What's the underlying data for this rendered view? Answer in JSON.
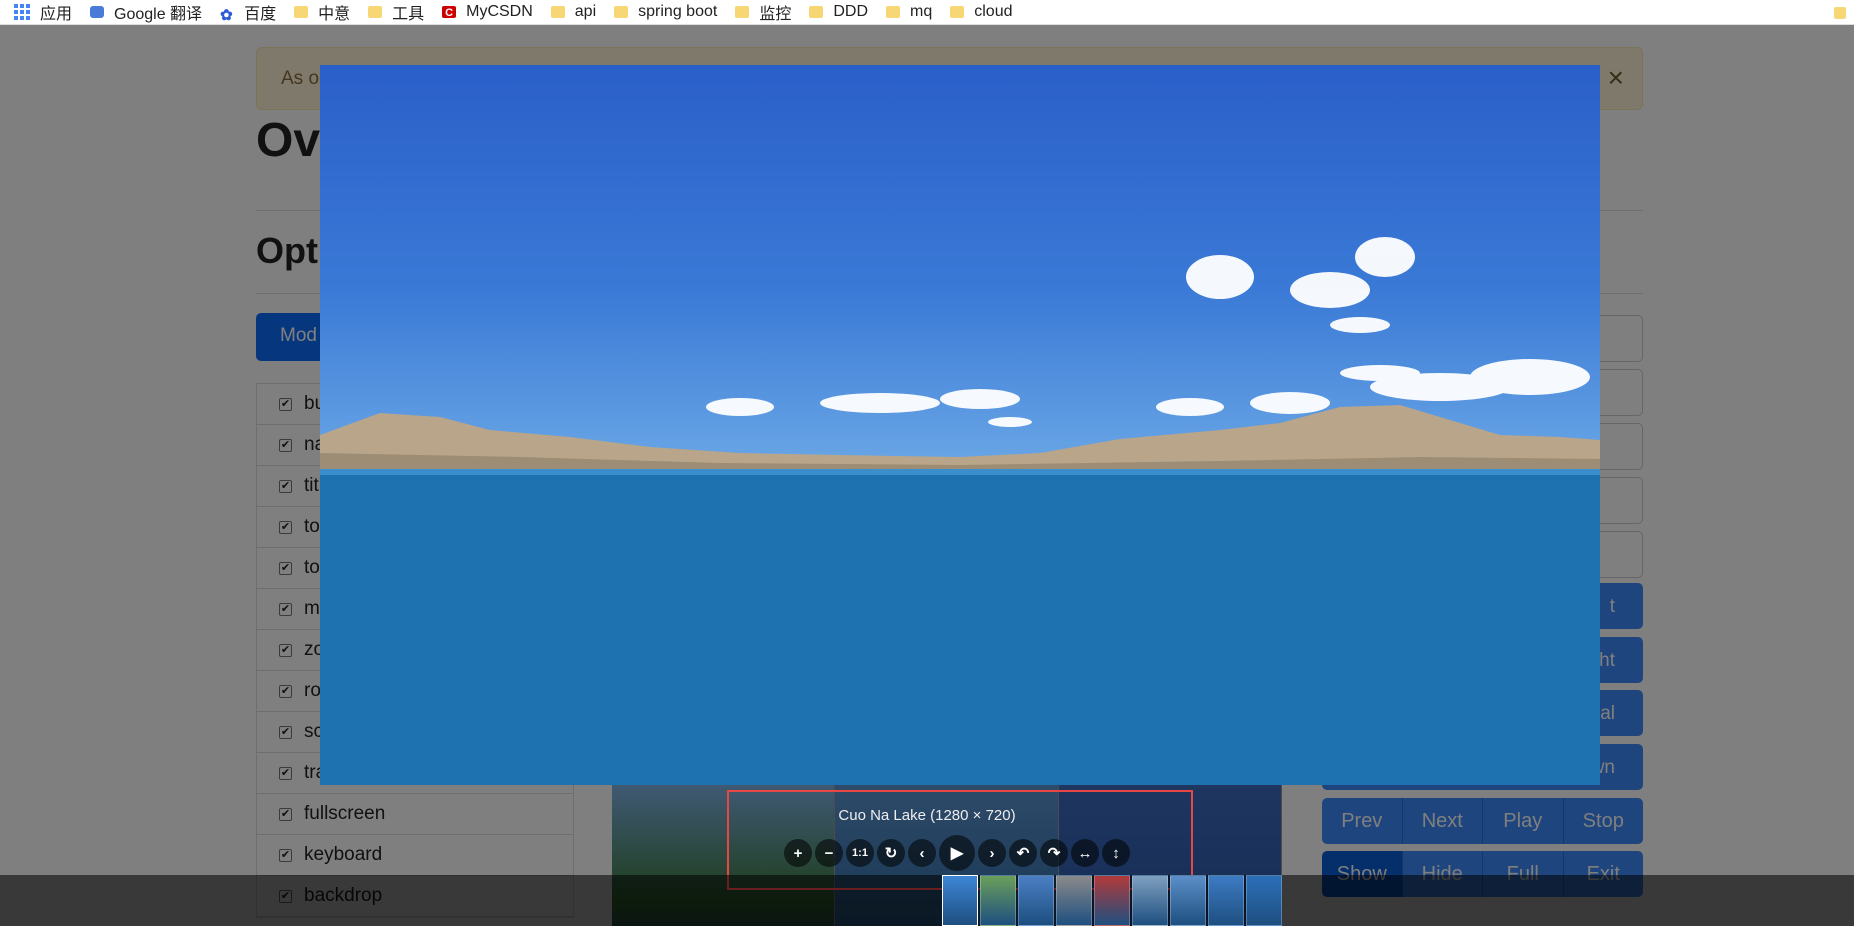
{
  "bookmarks": [
    {
      "label": "应用",
      "icon": "apps-grid-icon"
    },
    {
      "label": "Google 翻译",
      "icon": "google-translate-icon"
    },
    {
      "label": "百度",
      "icon": "baidu-icon"
    },
    {
      "label": "中意",
      "icon": "folder-icon"
    },
    {
      "label": "工具",
      "icon": "folder-icon"
    },
    {
      "label": "MyCSDN",
      "icon": "csdn-icon"
    },
    {
      "label": "api",
      "icon": "folder-icon"
    },
    {
      "label": "spring boot",
      "icon": "folder-icon"
    },
    {
      "label": "监控",
      "icon": "folder-icon"
    },
    {
      "label": "DDD",
      "icon": "folder-icon"
    },
    {
      "label": "mq",
      "icon": "folder-icon"
    },
    {
      "label": "cloud",
      "icon": "folder-icon"
    }
  ],
  "page": {
    "alert_text": "As o",
    "alert_close": "×",
    "heading": "Ov",
    "subheading": "Opti",
    "mode_button": "Mod",
    "options": [
      {
        "label": "bu",
        "checked": true
      },
      {
        "label": "na",
        "checked": true
      },
      {
        "label": "tit",
        "checked": true
      },
      {
        "label": "to",
        "checked": true
      },
      {
        "label": "to",
        "checked": true
      },
      {
        "label": "m",
        "checked": true
      },
      {
        "label": "zo",
        "checked": true
      },
      {
        "label": "ro",
        "checked": true
      },
      {
        "label": "sc",
        "checked": true
      },
      {
        "label": "tra",
        "checked": true
      },
      {
        "label": "fullscreen",
        "checked": true
      },
      {
        "label": "keyboard",
        "checked": true
      },
      {
        "label": "backdrop",
        "checked": true
      }
    ],
    "right_buttons": [
      "t",
      "ht",
      "al",
      "wn"
    ],
    "button_group_1": [
      "Prev",
      "Next",
      "Play",
      "Stop"
    ],
    "button_group_2": [
      "Show",
      "Hide",
      "Full",
      "Exit"
    ]
  },
  "viewer": {
    "title": "Cuo Na Lake (1280 × 720)",
    "toolbar": [
      {
        "name": "zoom-in-button",
        "glyph": "+"
      },
      {
        "name": "zoom-out-button",
        "glyph": "−"
      },
      {
        "name": "one-to-one-button",
        "glyph": "1:1"
      },
      {
        "name": "reset-button",
        "glyph": "↻"
      },
      {
        "name": "prev-button",
        "glyph": "‹"
      },
      {
        "name": "play-button",
        "glyph": "▶"
      },
      {
        "name": "next-button",
        "glyph": "›"
      },
      {
        "name": "rotate-left-button",
        "glyph": "↶"
      },
      {
        "name": "rotate-right-button",
        "glyph": "↷"
      },
      {
        "name": "flip-horizontal-button",
        "glyph": "↔"
      },
      {
        "name": "flip-vertical-button",
        "glyph": "↕"
      }
    ],
    "thumb_count": 9,
    "active_thumb": 0
  },
  "colors": {
    "primary": "#3d8bfd",
    "highlight": "#e84545",
    "lake": "#1a6aa8",
    "sky": "#2a5fc9"
  }
}
